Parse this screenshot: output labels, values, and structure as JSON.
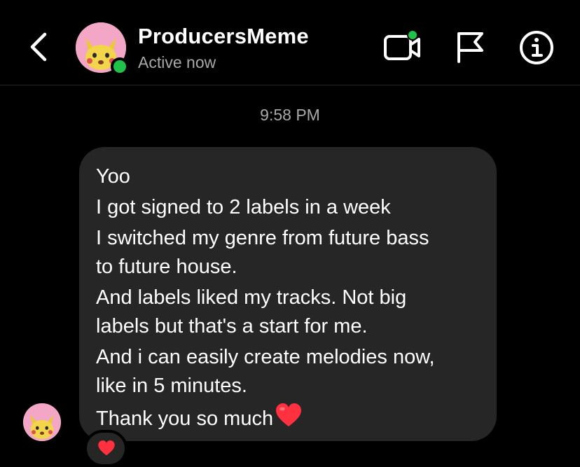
{
  "header": {
    "title": "ProducersMeme",
    "status": "Active now",
    "online_color": "#1fc24a",
    "icons": [
      "chevron-left-icon",
      "video-call-icon",
      "flag-icon",
      "info-icon"
    ]
  },
  "thread": {
    "timestamp": "9:58 PM",
    "message": {
      "lines": [
        "Yoo",
        "I got signed to 2 labels in a week",
        "I switched my genre from future bass",
        "to future house.",
        "And labels liked my tracks. Not big",
        "labels but that's a start for me.",
        "And i can easily create melodies now,",
        "like in 5 minutes.",
        "Thank you so much"
      ],
      "reaction": "heart-icon"
    }
  },
  "colors": {
    "background": "#000000",
    "bubble": "#262626",
    "muted_text": "#a8a8a8",
    "heart": "#ff3040"
  }
}
